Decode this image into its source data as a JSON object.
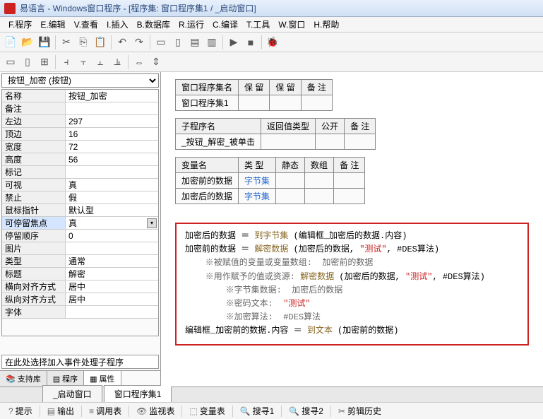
{
  "title": "易语言 - Windows窗口程序 - [程序集: 窗口程序集1 / _启动窗口]",
  "menu": {
    "file": "F.程序",
    "edit": "E.编辑",
    "view": "V.查看",
    "insert": "I.插入",
    "database": "B.数据库",
    "run": "R.运行",
    "compile": "C.编译",
    "tools": "T.工具",
    "window": "W.窗口",
    "help": "H.帮助"
  },
  "sidebar": {
    "combo": "按钮_加密 (按钮)",
    "props": [
      {
        "name": "名称",
        "val": "按钮_加密"
      },
      {
        "name": "备注",
        "val": ""
      },
      {
        "name": "左边",
        "val": "297"
      },
      {
        "name": "顶边",
        "val": "16"
      },
      {
        "name": "宽度",
        "val": "72"
      },
      {
        "name": "高度",
        "val": "56"
      },
      {
        "name": "标记",
        "val": ""
      },
      {
        "name": "可视",
        "val": "真"
      },
      {
        "name": "禁止",
        "val": "假"
      },
      {
        "name": "鼠标指针",
        "val": "默认型"
      },
      {
        "name": "可停留焦点",
        "val": "真",
        "hl": true,
        "dd": true
      },
      {
        "name": "  停留顺序",
        "val": "0"
      },
      {
        "name": "图片",
        "val": ""
      },
      {
        "name": "类型",
        "val": "通常"
      },
      {
        "name": "标题",
        "val": "解密"
      },
      {
        "name": "横向对齐方式",
        "val": "居中"
      },
      {
        "name": "纵向对齐方式",
        "val": "居中"
      },
      {
        "name": "字体",
        "val": ""
      }
    ],
    "events_placeholder": "在此处选择加入事件处理子程序",
    "tabs": {
      "lib": "支持库",
      "proc": "程序",
      "prop": "属性"
    }
  },
  "tables": {
    "t1": {
      "headers": [
        "窗口程序集名",
        "保 留",
        "保 留",
        "备 注"
      ],
      "row": [
        "窗口程序集1",
        "",
        "",
        ""
      ]
    },
    "t2": {
      "headers": [
        "子程序名",
        "返回值类型",
        "公开",
        "备 注"
      ],
      "row": [
        "_按钮_解密_被单击",
        "",
        "",
        ""
      ]
    },
    "t3": {
      "headers": [
        "变量名",
        "类 型",
        "静态",
        "数组",
        "备 注"
      ],
      "rows": [
        [
          "加密前的数据",
          "字节集",
          "",
          "",
          ""
        ],
        [
          "加密后的数据",
          "字节集",
          "",
          "",
          ""
        ]
      ]
    }
  },
  "code": {
    "l1a": "加密后的数据 ＝ ",
    "l1b": "到字节集",
    "l1c": " (编辑框_加密后的数据.内容)",
    "l2a": "加密前的数据 ＝ ",
    "l2b": "解密数据",
    "l2c": " (加密后的数据, ",
    "l2d": "\"测试\"",
    "l2e": ", #DES算法)",
    "l3": "    ※被赋值的变量或变量数组:  加密前的数据",
    "l4a": "    ※用作赋予的值或资源: ",
    "l4b": "解密数据",
    "l4c": " (加密后的数据, ",
    "l4d": "\"测试\"",
    "l4e": ", #DES算法)",
    "l5": "        ※字节集数据:  加密后的数据",
    "l6a": "        ※密码文本:  ",
    "l6b": "\"测试\"",
    "l7": "        ※加密算法:  #DES算法",
    "l8a": "编辑框_加密前的数据.内容 ＝ ",
    "l8b": "到文本",
    "l8c": " (加密前的数据)"
  },
  "bottom_tabs": {
    "start": "_启动窗口",
    "procset": "窗口程序集1"
  },
  "statusbar": {
    "hint": "提示",
    "output": "输出",
    "callstack": "调用表",
    "watch": "监视表",
    "vars": "变量表",
    "search1": "搜寻1",
    "search2": "搜寻2",
    "clip": "剪辑历史"
  }
}
